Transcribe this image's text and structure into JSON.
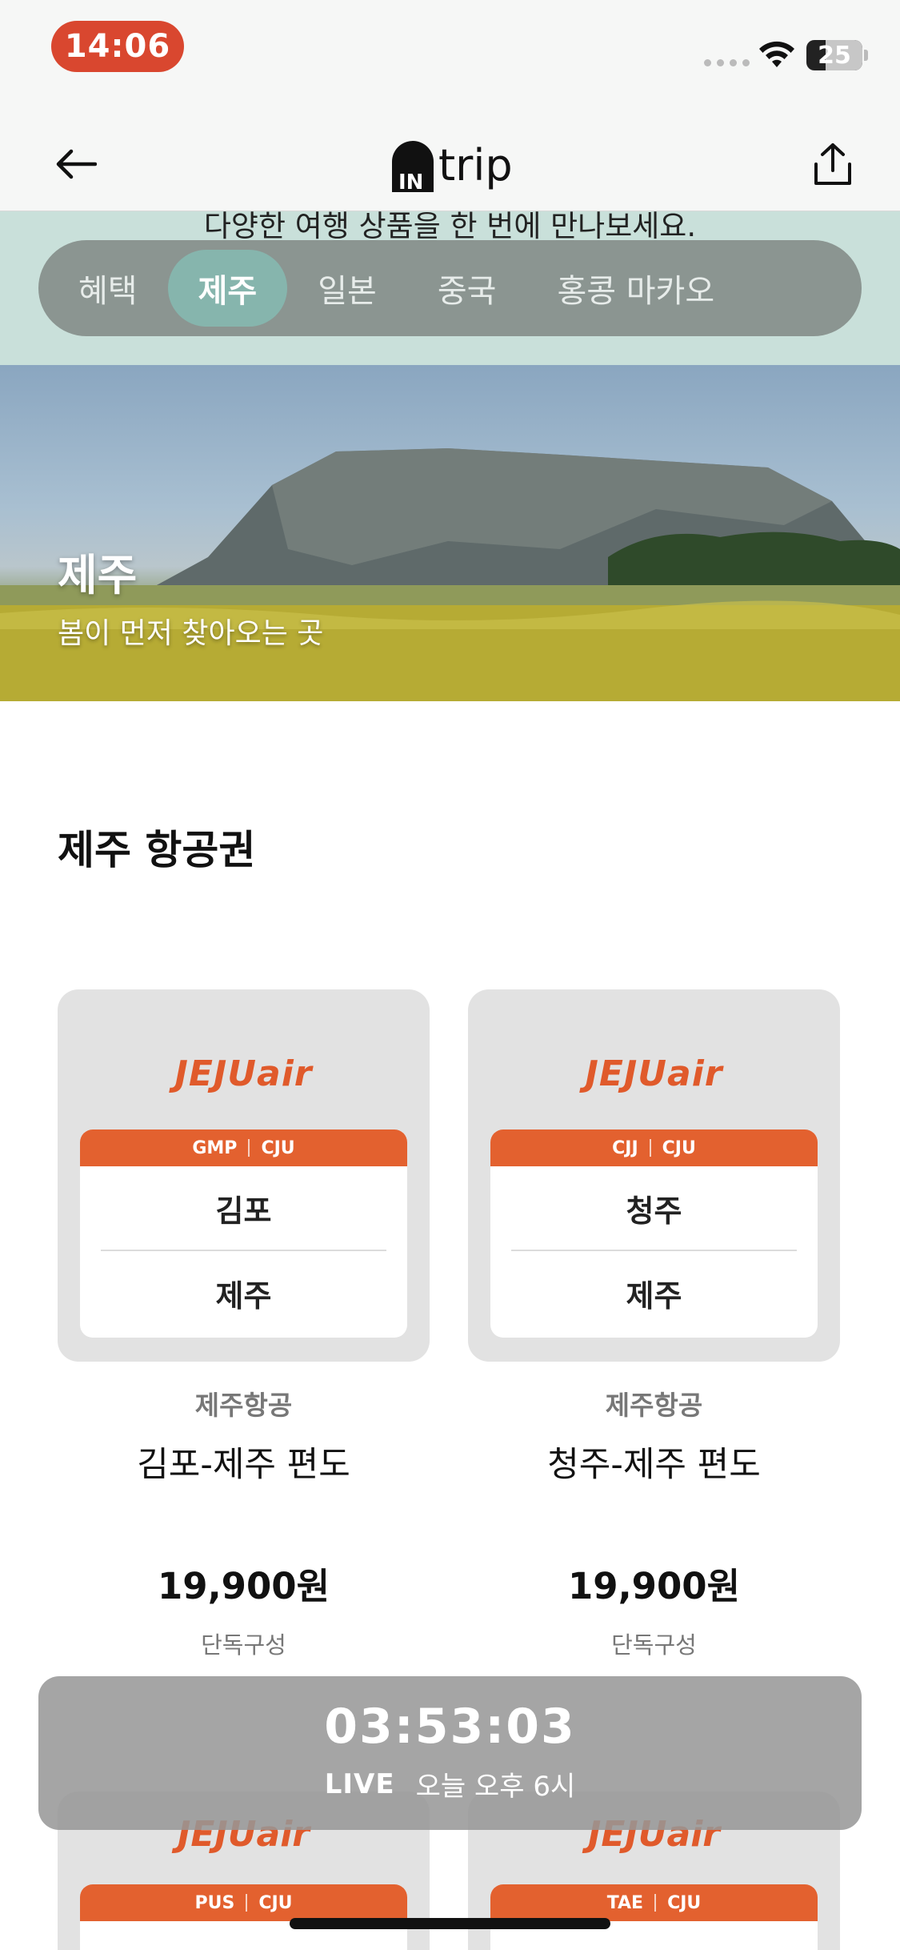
{
  "status_bar": {
    "time": "14:06",
    "battery": "25"
  },
  "nav": {
    "logo_prefix": "IN",
    "logo_text": "trip"
  },
  "banner_text": "다양한 여행 상품을 한 번에 만나보세요.",
  "tabs": [
    {
      "label": "혜택",
      "active": false
    },
    {
      "label": "제주",
      "active": true
    },
    {
      "label": "일본",
      "active": false
    },
    {
      "label": "중국",
      "active": false
    },
    {
      "label": "홍콩 마카오",
      "active": false
    }
  ],
  "hero": {
    "title": "제주",
    "subtitle": "봄이 먼저 찾아오는 곳"
  },
  "section": {
    "title": "제주 항공권"
  },
  "cards": [
    {
      "logo": "JEJUair",
      "from_code": "GMP",
      "to_code": "CJU",
      "from": "김포",
      "to": "제주",
      "airline": "제주항공",
      "route": "김포-제주 편도",
      "price": "19,900원",
      "note": "단독구성"
    },
    {
      "logo": "JEJUair",
      "from_code": "CJJ",
      "to_code": "CJU",
      "from": "청주",
      "to": "제주",
      "airline": "제주항공",
      "route": "청주-제주 편도",
      "price": "19,900원",
      "note": "단독구성"
    }
  ],
  "lower_cards": [
    {
      "logo": "JEJUair",
      "from_code": "PUS",
      "to_code": "CJU"
    },
    {
      "logo": "JEJUair",
      "from_code": "TAE",
      "to_code": "CJU"
    }
  ],
  "live": {
    "timer": "03:53:03",
    "label": "LIVE",
    "time": "오늘 오후 6시"
  },
  "colors": {
    "accent": "#e3612f",
    "tab_active": "#86b5ad",
    "band": "#c9e0da",
    "status_pill": "#d9472f"
  }
}
